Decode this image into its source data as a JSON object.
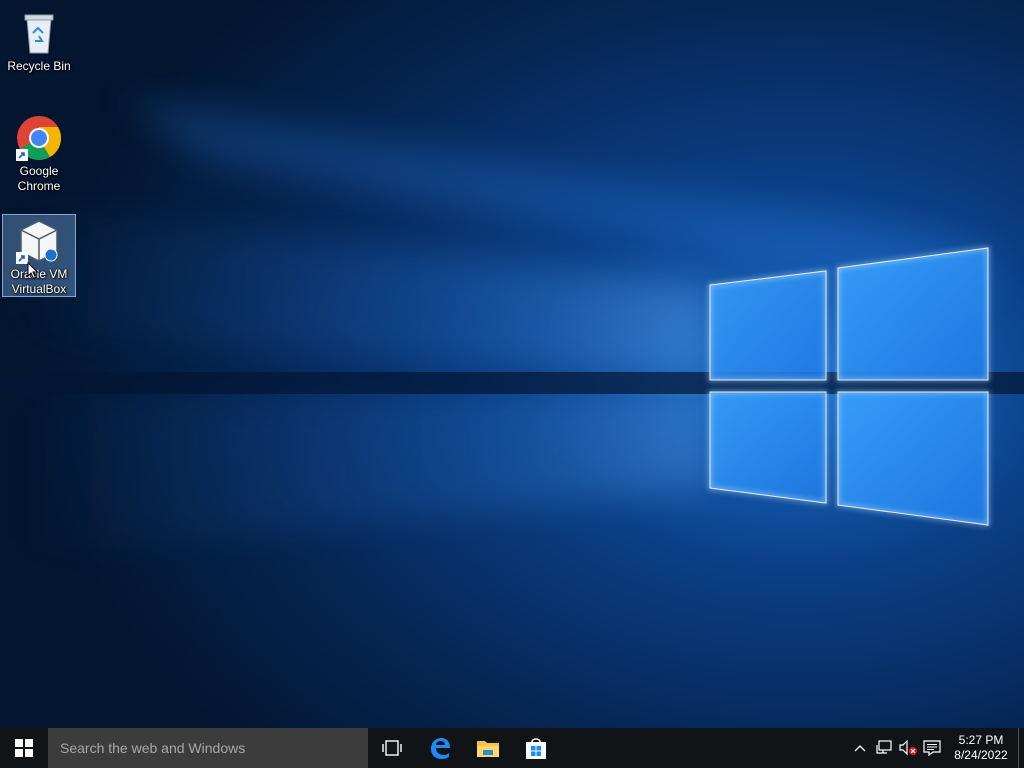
{
  "desktop": {
    "icons": [
      {
        "label": "Recycle Bin",
        "icon": "recycle-bin-icon"
      },
      {
        "label": "Google Chrome",
        "icon": "chrome-icon"
      },
      {
        "label": "Oracle VM VirtualBox",
        "icon": "virtualbox-icon",
        "selected": true
      }
    ]
  },
  "taskbar": {
    "search_placeholder": "Search the web and Windows",
    "apps": [
      "task-view-icon",
      "edge-icon",
      "file-explorer-icon",
      "store-icon"
    ],
    "tray": [
      "chevron-up-icon",
      "network-icon",
      "volume-muted-icon",
      "action-center-icon"
    ],
    "clock": {
      "time": "5:27 PM",
      "date": "8/24/2022"
    }
  },
  "colors": {
    "accent_blue": "#1a8cff",
    "taskbar_bg": "#111417",
    "search_bg": "#3c3c3c"
  }
}
